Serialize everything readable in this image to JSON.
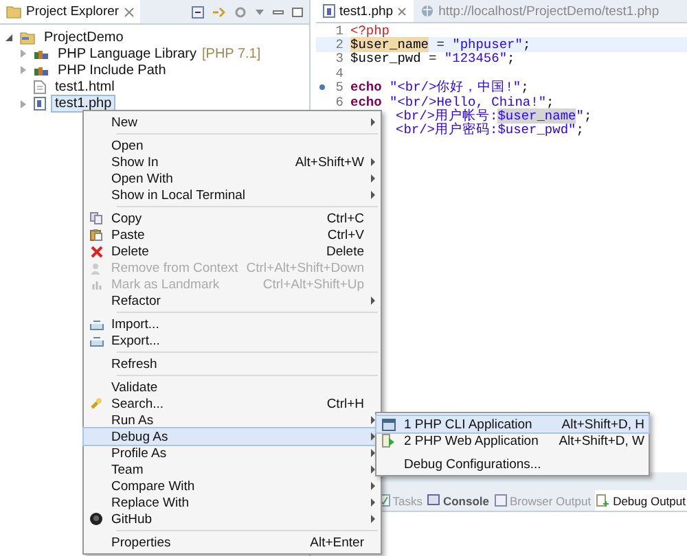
{
  "explorer": {
    "title": "Project Explorer",
    "tree": [
      {
        "label": "ProjectDemo",
        "kind": "project",
        "expanded": true,
        "selected": false,
        "children": [
          {
            "label": "PHP Language Library",
            "decoration": "[PHP 7.1]",
            "kind": "library",
            "expanded": false,
            "selected": false
          },
          {
            "label": "PHP Include Path",
            "kind": "library",
            "expanded": false,
            "selected": false
          },
          {
            "label": "test1.html",
            "kind": "file",
            "selected": false
          },
          {
            "label": "test1.php",
            "kind": "php",
            "expanded": false,
            "selected": true
          }
        ]
      }
    ]
  },
  "editor": {
    "tabs": [
      {
        "label": "test1.php",
        "kind": "file",
        "selected": true
      },
      {
        "label": "http://localhost/ProjectDemo/test1.php",
        "kind": "web",
        "selected": false
      }
    ],
    "lines": [
      {
        "number": "1",
        "current": false,
        "tokens": [
          {
            "text": "<?php",
            "kind": "tag"
          }
        ]
      },
      {
        "number": "2",
        "current": true,
        "tokens": [
          {
            "text": "$user_name",
            "kind": "var",
            "color": "#f1d9a8"
          },
          {
            "text": " = ",
            "kind": "plain"
          },
          {
            "text": "\"phpuser\"",
            "kind": "str"
          },
          {
            "text": ";",
            "kind": "plain"
          }
        ]
      },
      {
        "number": "3",
        "current": false,
        "tokens": [
          {
            "text": "$user_pwd",
            "kind": "var"
          },
          {
            "text": " = ",
            "kind": "plain"
          },
          {
            "text": "\"123456\"",
            "kind": "str"
          },
          {
            "text": ";",
            "kind": "plain"
          }
        ]
      },
      {
        "number": "4",
        "current": false
      },
      {
        "number": "5",
        "current": false,
        "marker": true,
        "tokens": [
          {
            "text": "echo",
            "kind": "kw"
          },
          {
            "text": "\"<br/>你好，中国!\"",
            "kind": "str"
          },
          {
            "text": ";",
            "kind": "plain"
          }
        ]
      },
      {
        "number": "6",
        "current": false,
        "tokens": [
          {
            "text": "echo",
            "kind": "kw"
          },
          {
            "text": "\"<br/>Hello, China!\"",
            "kind": "str"
          },
          {
            "text": ";",
            "kind": "plain"
          }
        ]
      },
      {
        "current": false,
        "tokens": [
          {
            "text": "<br/>用户帐号:",
            "kind": "str"
          },
          {
            "text": "$user_name",
            "kind": "str",
            "color": "#d4d4d4"
          },
          {
            "text": "\"",
            "kind": "str"
          },
          {
            "text": ";",
            "kind": "plain"
          }
        ]
      },
      {
        "current": false,
        "tokens": [
          {
            "text": "<br/>用户密码:$user_pwd\"",
            "kind": "str"
          },
          {
            "text": ";",
            "kind": "plain"
          }
        ]
      }
    ]
  },
  "bottom_tabs": [
    {
      "label": "Tasks",
      "kind": "tasks",
      "selected": false
    },
    {
      "label": "Console",
      "kind": "console",
      "selected": false
    },
    {
      "label": "Browser Output",
      "kind": "browser",
      "selected": false
    },
    {
      "label": "Debug Output",
      "kind": "debug",
      "selected": true
    }
  ],
  "context_menu": [
    {
      "kind": "plain",
      "label": "New",
      "submenu": true
    },
    {
      "kind": "separator"
    },
    {
      "kind": "plain",
      "label": "Open"
    },
    {
      "kind": "plain",
      "label": "Show In",
      "shortcut": "Alt+Shift+W",
      "submenu": true
    },
    {
      "kind": "plain",
      "label": "Open With",
      "submenu": true
    },
    {
      "kind": "plain",
      "label": "Show in Local Terminal",
      "submenu": true
    },
    {
      "kind": "separator"
    },
    {
      "kind": "copy",
      "label": "Copy",
      "shortcut": "Ctrl+C"
    },
    {
      "kind": "paste",
      "label": "Paste",
      "shortcut": "Ctrl+V"
    },
    {
      "kind": "delete",
      "label": "Delete",
      "shortcut": "Delete"
    },
    {
      "kind": "remove",
      "label": "Remove from Context",
      "shortcut": "Ctrl+Alt+Shift+Down",
      "disabled": true
    },
    {
      "kind": "mark",
      "label": "Mark as Landmark",
      "shortcut": "Ctrl+Alt+Shift+Up",
      "disabled": true
    },
    {
      "kind": "plain",
      "label": "Refactor",
      "submenu": true
    },
    {
      "kind": "separator"
    },
    {
      "kind": "import",
      "label": "Import..."
    },
    {
      "kind": "export",
      "label": "Export..."
    },
    {
      "kind": "separator"
    },
    {
      "kind": "plain",
      "label": "Refresh"
    },
    {
      "kind": "separator"
    },
    {
      "kind": "plain",
      "label": "Validate"
    },
    {
      "kind": "search",
      "label": "Search...",
      "shortcut": "Ctrl+H"
    },
    {
      "kind": "plain",
      "label": "Run As",
      "submenu": true
    },
    {
      "kind": "plain",
      "label": "Debug As",
      "submenu": true,
      "selected": true
    },
    {
      "kind": "plain",
      "label": "Profile As",
      "submenu": true
    },
    {
      "kind": "plain",
      "label": "Team",
      "submenu": true
    },
    {
      "kind": "plain",
      "label": "Compare With",
      "submenu": true
    },
    {
      "kind": "plain",
      "label": "Replace With",
      "submenu": true
    },
    {
      "kind": "github",
      "label": "GitHub",
      "submenu": true
    },
    {
      "kind": "separator"
    },
    {
      "kind": "plain",
      "label": "Properties",
      "shortcut": "Alt+Enter"
    }
  ],
  "submenu": [
    {
      "kind": "cli",
      "label": "1 PHP CLI Application",
      "shortcut": "Alt+Shift+D, H",
      "selected": true
    },
    {
      "kind": "web",
      "label": "2 PHP Web Application",
      "shortcut": "Alt+Shift+D, W",
      "selected": false
    },
    {
      "kind": "separator"
    },
    {
      "kind": "plain",
      "label": "Debug Configurations...",
      "selected": false
    }
  ]
}
